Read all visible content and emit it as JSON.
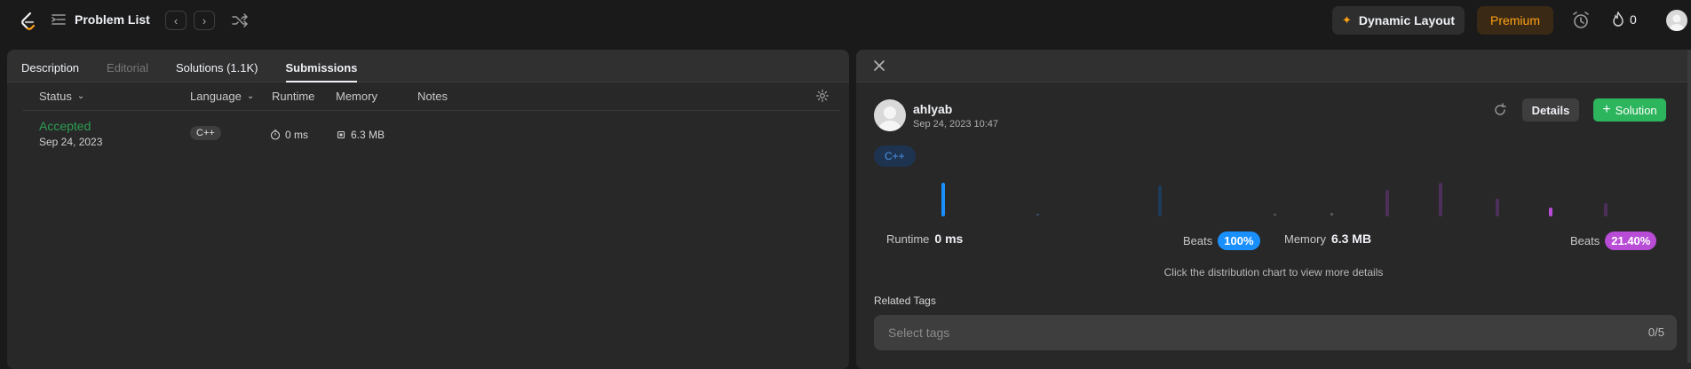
{
  "navbar": {
    "problem_list_label": "Problem List",
    "dynamic_layout_label": "Dynamic Layout",
    "premium_label": "Premium",
    "streak_count": "0",
    "accent_color": "#ffa116"
  },
  "left_tabs": [
    {
      "label": "Description"
    },
    {
      "label": "Editorial"
    },
    {
      "label": "Solutions (1.1K)"
    },
    {
      "label": "Submissions"
    }
  ],
  "table": {
    "headers": {
      "status": "Status",
      "language": "Language",
      "runtime": "Runtime",
      "memory": "Memory",
      "notes": "Notes"
    },
    "rows": [
      {
        "status": "Accepted",
        "date": "Sep 24, 2023",
        "language": "C++",
        "runtime": "0 ms",
        "memory": "6.3 MB"
      }
    ]
  },
  "detail": {
    "username": "ahlyab",
    "datetime": "Sep 24, 2023 10:47",
    "details_label": "Details",
    "solution_label": "Solution",
    "language_tag": "C++",
    "runtime_label": "Runtime",
    "runtime_value": "0 ms",
    "runtime_beats_label": "Beats",
    "runtime_beats_value": "100%",
    "memory_label": "Memory",
    "memory_value": "6.3 MB",
    "memory_beats_label": "Beats",
    "memory_beats_value": "21.40%",
    "hint": "Click the distribution chart to view more details",
    "related_tags_label": "Related Tags",
    "tags_placeholder": "Select tags",
    "tags_count": "0/5"
  },
  "colors": {
    "accepted": "#2cbb5d",
    "runtime_pill": "#1a90ff",
    "memory_pill": "#b84cd6",
    "solution_button": "#2db55d"
  }
}
